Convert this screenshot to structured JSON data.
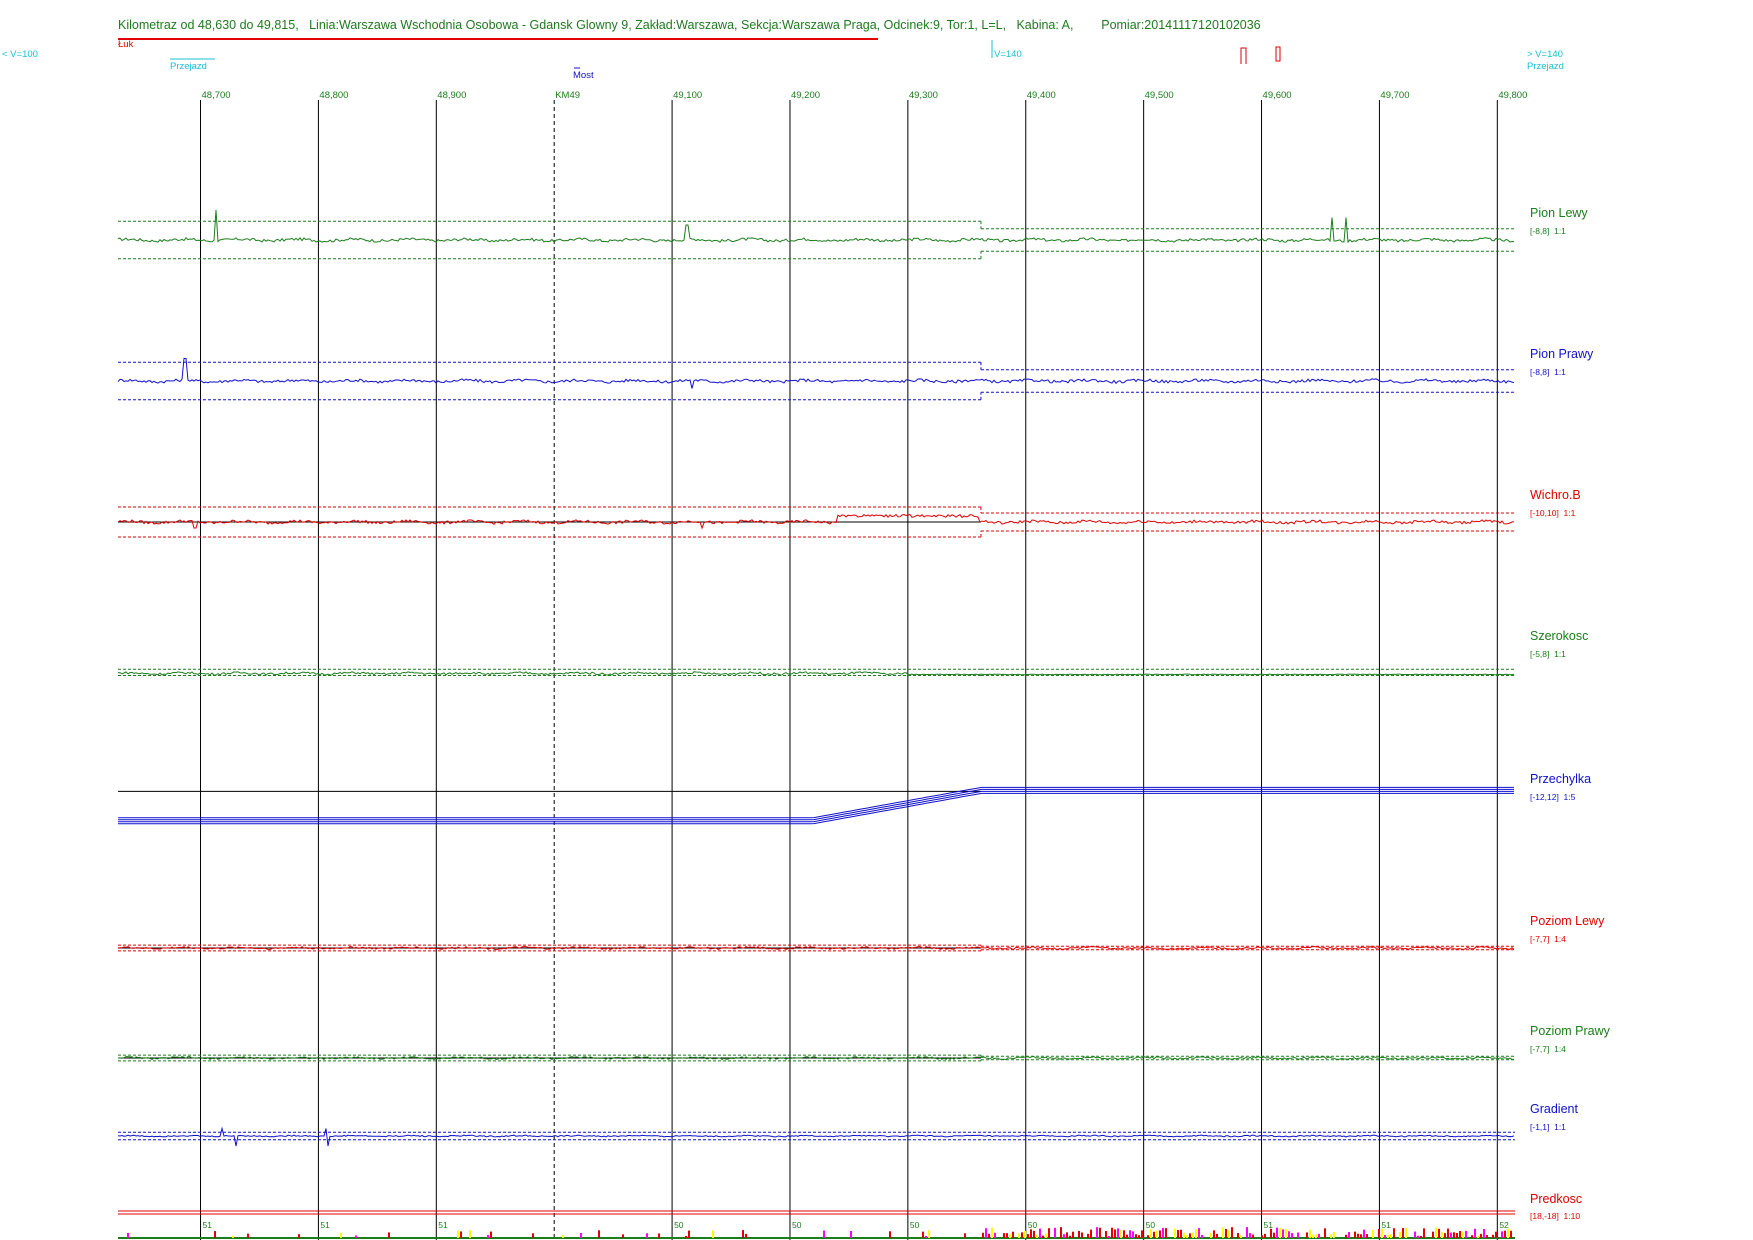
{
  "header": {
    "title": "Kilometraz od 48,630 do 49,815,   Linia:Warszawa Wschodnia Osobowa - Gdansk Glowny 9, Zakład:Warszawa, Sekcja:Warszawa Praga, Odcinek:9, Tor:1, L=L,   Kabina: A,        Pomiar:20141117120102036",
    "luk_label": "Łuk",
    "speed_left": "< V=100",
    "speed_mid": "V=140",
    "speed_right": "> V=140",
    "crossing_left": "Przejazd",
    "crossing_right": "Przejazd",
    "bridge": "Most"
  },
  "colors": {
    "green": "#1b7d1b",
    "blue": "#1010d0",
    "red": "#e00000",
    "black": "#000000",
    "cyan": "#19c0d0"
  },
  "chart_data": {
    "type": "line",
    "x_unit": "km",
    "xlim": [
      48.63,
      49.815
    ],
    "km_ticks": [
      {
        "km": 48.7,
        "label": "48,700"
      },
      {
        "km": 48.8,
        "label": "48,800"
      },
      {
        "km": 48.9,
        "label": "48,900"
      },
      {
        "km": 49.0,
        "label": "KM49"
      },
      {
        "km": 49.1,
        "label": "49,100"
      },
      {
        "km": 49.2,
        "label": "49,200"
      },
      {
        "km": 49.3,
        "label": "49,300"
      },
      {
        "km": 49.4,
        "label": "49,400"
      },
      {
        "km": 49.5,
        "label": "49,500"
      },
      {
        "km": 49.6,
        "label": "49,600"
      },
      {
        "km": 49.7,
        "label": "49,700"
      },
      {
        "km": 49.8,
        "label": "49,800"
      }
    ],
    "channels": [
      {
        "name": "Pion Lewy",
        "range_label": "[-8,8]  1:1",
        "color": "#1b7d1b",
        "ylim": [
          -8,
          8
        ],
        "tolerance": [
          {
            "from": 48.63,
            "to": 49.362,
            "low": -2.5,
            "high": 2.5
          },
          {
            "from": 49.362,
            "to": 49.815,
            "low": -1.5,
            "high": 1.5
          }
        ],
        "spikes": [
          {
            "km": 48.713,
            "value": 4.0
          },
          {
            "km": 49.113,
            "value": 2.0
          },
          {
            "km": 49.66,
            "value": 3.0
          },
          {
            "km": 49.672,
            "value": 3.0
          }
        ]
      },
      {
        "name": "Pion Prawy",
        "range_label": "[-8,8]  1:1",
        "color": "#1010d0",
        "ylim": [
          -8,
          8
        ],
        "tolerance": [
          {
            "from": 48.63,
            "to": 49.362,
            "low": -2.5,
            "high": 2.5
          },
          {
            "from": 49.362,
            "to": 49.815,
            "low": -1.5,
            "high": 1.5
          }
        ],
        "spikes": [
          {
            "km": 48.687,
            "value": 3.0
          },
          {
            "km": 49.117,
            "value": -1.0
          }
        ]
      },
      {
        "name": "Wichro.B",
        "range_label": "[-10,10]  1:1",
        "color": "#e00000",
        "ylim": [
          -10,
          10
        ],
        "tolerance": [
          {
            "from": 48.63,
            "to": 49.362,
            "low": -2.5,
            "high": 2.5
          },
          {
            "from": 49.362,
            "to": 49.815,
            "low": -1.5,
            "high": 1.5
          }
        ],
        "spikes": [
          {
            "km": 48.695,
            "value": -1.0
          },
          {
            "km": 49.125,
            "value": -1.0
          }
        ]
      },
      {
        "name": "Szerokosc",
        "range_label": "[-5,8]  1:1",
        "color": "#1b7d1b",
        "ylim": [
          -5,
          8
        ],
        "tolerance": [
          {
            "from": 48.63,
            "to": 49.362,
            "low": -0.3,
            "high": 0.6
          },
          {
            "from": 49.362,
            "to": 49.815,
            "low": -0.3,
            "high": 0.6
          }
        ],
        "spikes": []
      },
      {
        "name": "Przechylka",
        "range_label": "[-12,12]  1:5",
        "color": "#1010d0",
        "ylim": [
          -12,
          12
        ],
        "tolerance": [],
        "spikes": []
      },
      {
        "name": "Poziom Lewy",
        "range_label": "[-7,7]  1:4",
        "color": "#e00000",
        "ylim": [
          -7,
          7
        ],
        "tolerance": [
          {
            "from": 48.63,
            "to": 49.362,
            "low": -0.5,
            "high": 0.5
          },
          {
            "from": 49.362,
            "to": 49.815,
            "low": -0.3,
            "high": 0.3
          }
        ],
        "spikes": []
      },
      {
        "name": "Poziom Prawy",
        "range_label": "[-7,7]  1:4",
        "color": "#1b7d1b",
        "ylim": [
          -7,
          7
        ],
        "tolerance": [
          {
            "from": 48.63,
            "to": 49.362,
            "low": -0.5,
            "high": 0.5
          },
          {
            "from": 49.362,
            "to": 49.815,
            "low": -0.3,
            "high": 0.3
          }
        ],
        "spikes": []
      },
      {
        "name": "Gradient",
        "range_label": "[-1,1]  1:1",
        "color": "#1010d0",
        "ylim": [
          -1,
          1
        ],
        "tolerance": [
          {
            "from": 48.63,
            "to": 49.815,
            "low": -0.15,
            "high": 0.15
          }
        ],
        "spikes": [
          {
            "km": 48.73,
            "value": -0.4
          },
          {
            "km": 48.718,
            "value": 0.3
          },
          {
            "km": 48.808,
            "value": -0.4
          },
          {
            "km": 48.806,
            "value": 0.3
          }
        ]
      },
      {
        "name": "Predkosc",
        "range_label": "[18,-18]  1:10",
        "color": "#e00000",
        "ylim": [
          -18,
          18
        ],
        "tolerance": [],
        "spikes": []
      }
    ],
    "speed_labels": [
      {
        "km": 48.7,
        "label": "51"
      },
      {
        "km": 48.8,
        "label": "51"
      },
      {
        "km": 48.9,
        "label": "51"
      },
      {
        "km": 49.1,
        "label": "50"
      },
      {
        "km": 49.2,
        "label": "50"
      },
      {
        "km": 49.3,
        "label": "50"
      },
      {
        "km": 49.4,
        "label": "50"
      },
      {
        "km": 49.5,
        "label": "50"
      },
      {
        "km": 49.6,
        "label": "51"
      },
      {
        "km": 49.7,
        "label": "51"
      },
      {
        "km": 49.8,
        "label": "52"
      }
    ]
  }
}
